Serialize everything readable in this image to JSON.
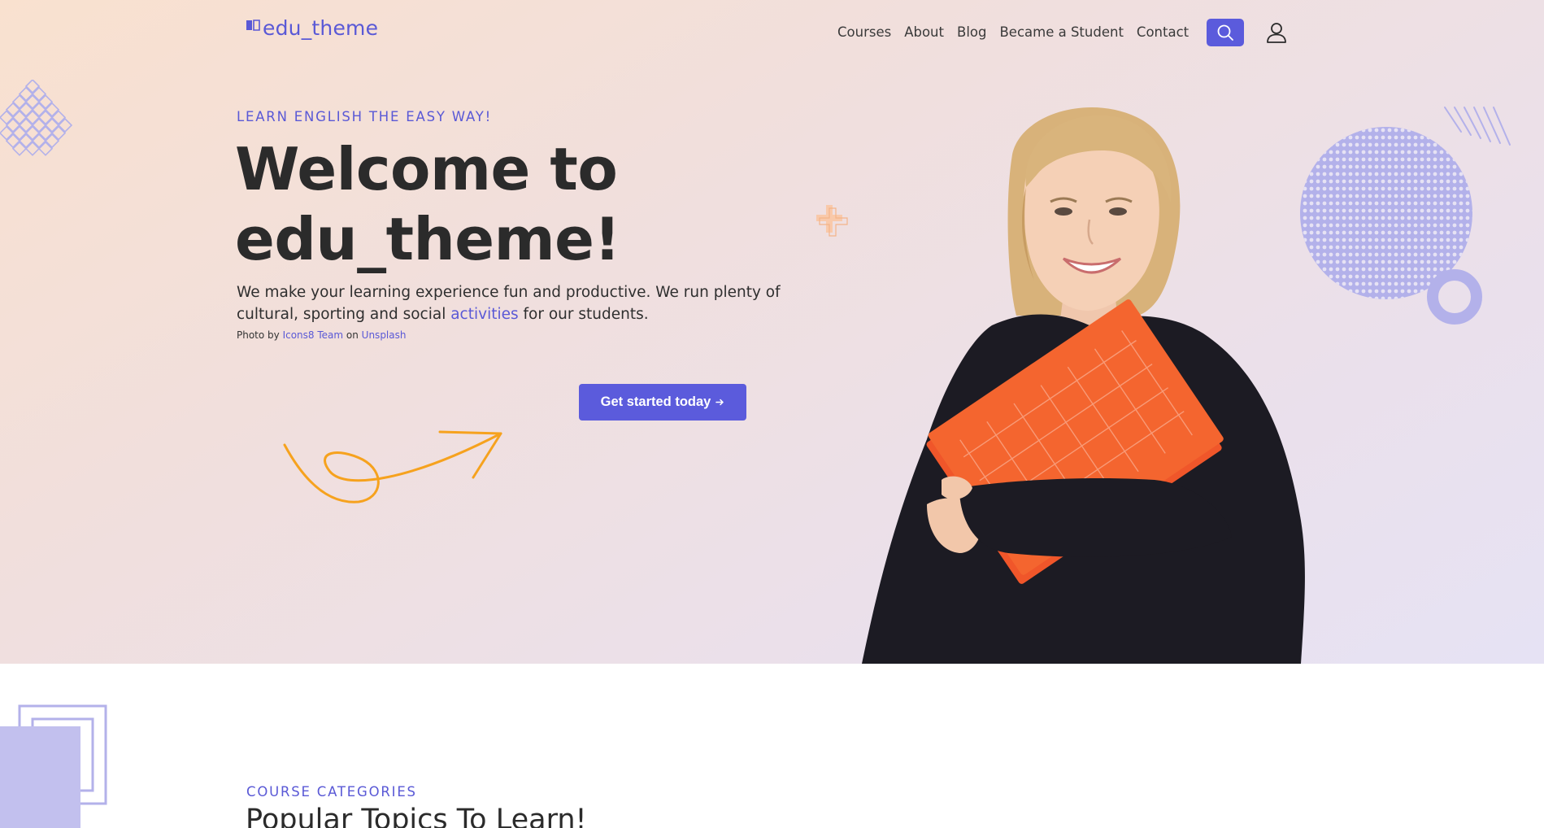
{
  "header": {
    "logo_text": "edu_theme",
    "nav": [
      "Courses",
      "About",
      "Blog",
      "Became a Student",
      "Contact"
    ],
    "icons": {
      "search": "search-icon",
      "user": "user-icon",
      "logo": "book-icon"
    }
  },
  "hero": {
    "eyebrow": "LEARN ENGLISH THE EASY WAY!",
    "headline_line1": "Welcome to",
    "headline_line2": "edu_theme!",
    "lead_before": "We make your learning experience fun and productive. We run plenty of cultural, sporting and social ",
    "lead_link": "activities",
    "lead_after": " for our students.",
    "credit_prefix": "Photo by ",
    "credit_author": "Icons8 Team",
    "credit_mid": " on ",
    "credit_source": "Unsplash",
    "cta_label": "Get started today",
    "cta_icon": "arrow-right-icon"
  },
  "section2": {
    "eyebrow": "COURSE CATEGORIES",
    "title": "Popular Topics To Learn!"
  },
  "colors": {
    "accent": "#5b5bdc",
    "orange": "#f6a21e",
    "text": "#2b2b2b",
    "hero_bg_start": "#f9e1cf",
    "hero_bg_end": "#e6e2f4",
    "decor_purple": "#b3b1ea"
  }
}
